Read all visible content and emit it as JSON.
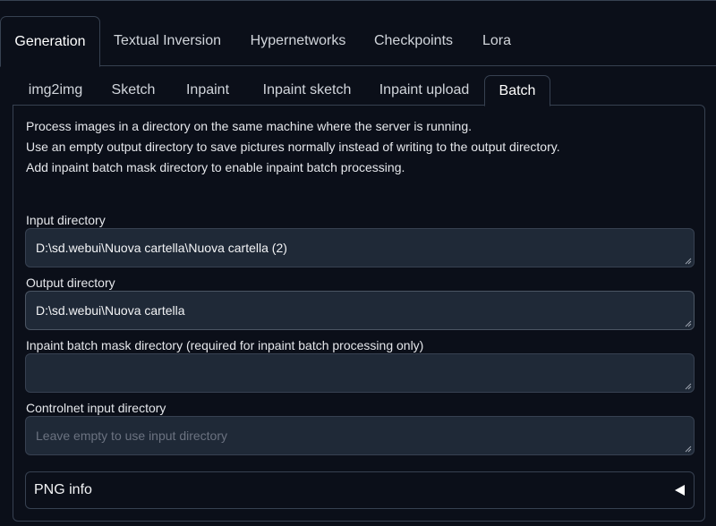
{
  "tabs_top": [
    {
      "label": "Generation",
      "active": true
    },
    {
      "label": "Textual Inversion",
      "active": false
    },
    {
      "label": "Hypernetworks",
      "active": false
    },
    {
      "label": "Checkpoints",
      "active": false
    },
    {
      "label": "Lora",
      "active": false
    }
  ],
  "tabs_sub": [
    {
      "label": "img2img",
      "active": false
    },
    {
      "label": "Sketch",
      "active": false
    },
    {
      "label": "Inpaint",
      "active": false
    },
    {
      "label": "Inpaint sketch",
      "active": false
    },
    {
      "label": "Inpaint upload",
      "active": false
    },
    {
      "label": "Batch",
      "active": true
    }
  ],
  "batch": {
    "description": [
      "Process images in a directory on the same machine where the server is running.",
      "Use an empty output directory to save pictures normally instead of writing to the output directory.",
      "Add inpaint batch mask directory to enable inpaint batch processing."
    ],
    "input_dir": {
      "label": "Input directory",
      "value": "D:\\sd.webui\\Nuova cartella\\Nuova cartella (2)"
    },
    "output_dir": {
      "label": "Output directory",
      "value": "D:\\sd.webui\\Nuova cartella"
    },
    "mask_dir": {
      "label": "Inpaint batch mask directory (required for inpaint batch processing only)",
      "value": ""
    },
    "controlnet_dir": {
      "label": "Controlnet input directory",
      "value": "",
      "placeholder": "Leave empty to use input directory"
    },
    "png_info": {
      "label": "PNG info",
      "icon": "caret-left-icon"
    }
  },
  "colors": {
    "background": "#0b0f19",
    "input_bg": "#1f2937",
    "border": "#374151"
  }
}
